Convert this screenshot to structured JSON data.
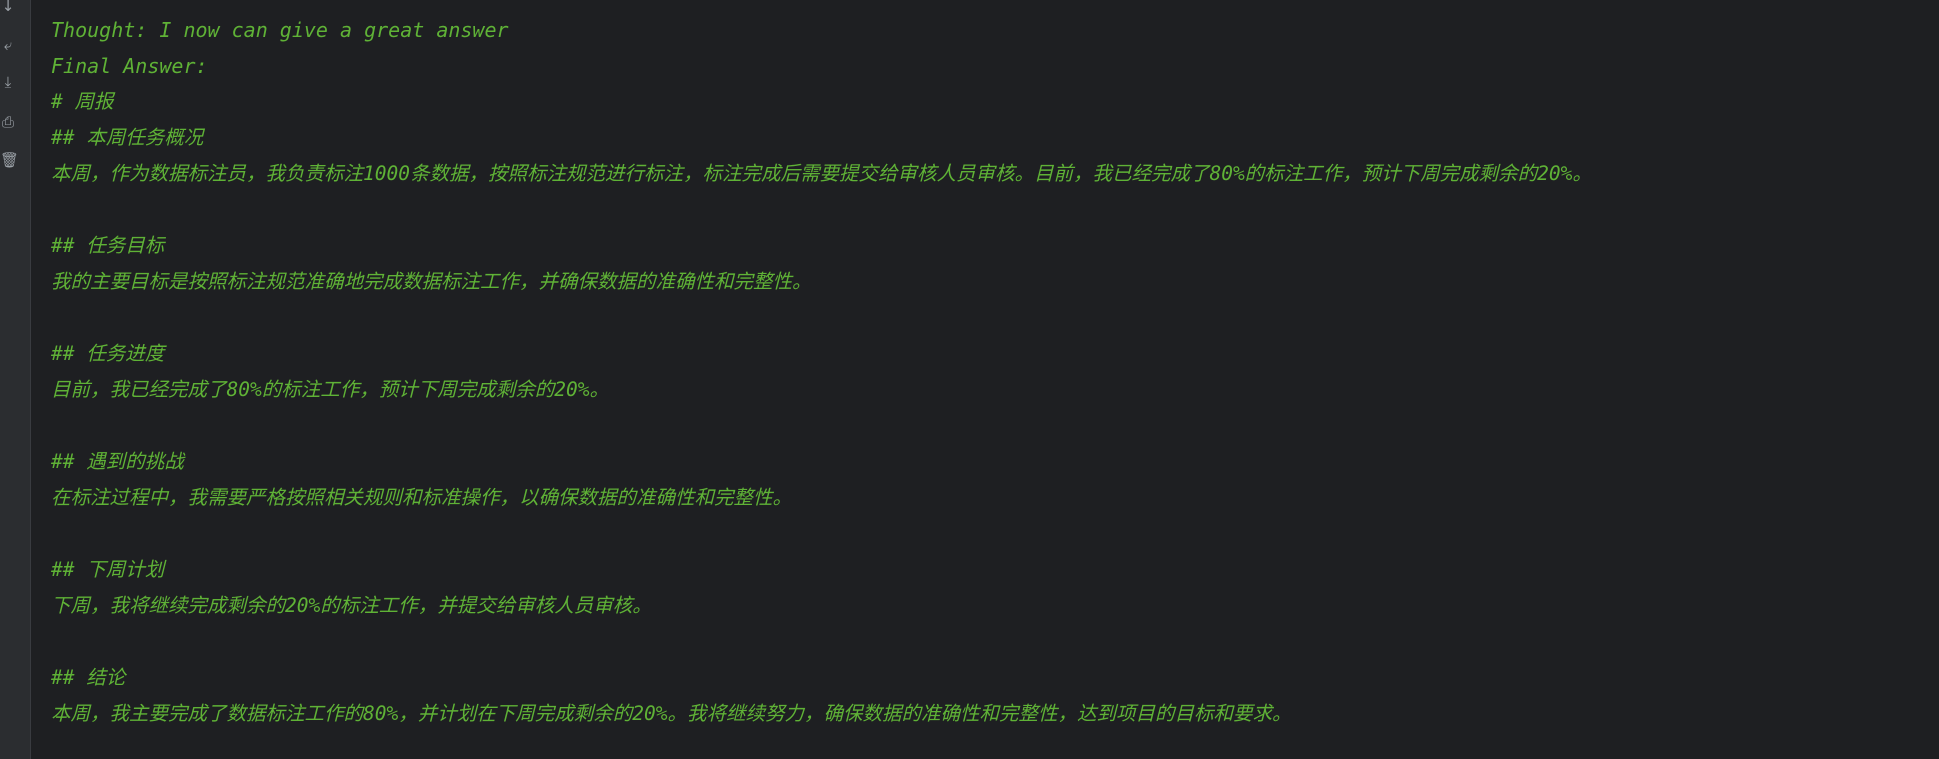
{
  "toolbar": {
    "icons": [
      "scroll-down-icon",
      "soft-wrap-icon",
      "download-icon",
      "print-icon",
      "trash-icon"
    ],
    "glyphs": [
      "↓",
      "⤶",
      "⤓",
      "⎙",
      "🗑"
    ]
  },
  "output": {
    "lines": [
      "Thought: I now can give a great answer",
      "Final Answer:",
      "# 周报",
      "## 本周任务概况",
      "本周，作为数据标注员，我负责标注1000条数据，按照标注规范进行标注，标注完成后需要提交给审核人员审核。目前，我已经完成了80%的标注工作，预计下周完成剩余的20%。",
      "",
      "## 任务目标",
      "我的主要目标是按照标注规范准确地完成数据标注工作，并确保数据的准确性和完整性。",
      "",
      "## 任务进度",
      "目前，我已经完成了80%的标注工作，预计下周完成剩余的20%。",
      "",
      "## 遇到的挑战",
      "在标注过程中，我需要严格按照相关规则和标准操作，以确保数据的准确性和完整性。",
      "",
      "## 下周计划",
      "下周，我将继续完成剩余的20%的标注工作，并提交给审核人员审核。",
      "",
      "## 结论",
      "本周，我主要完成了数据标注工作的80%，并计划在下周完成剩余的20%。我将继续努力，确保数据的准确性和完整性，达到项目的目标和要求。"
    ]
  },
  "colors": {
    "background": "#1e1f22",
    "gutter": "#2b2d30",
    "text": "#5fb236"
  }
}
